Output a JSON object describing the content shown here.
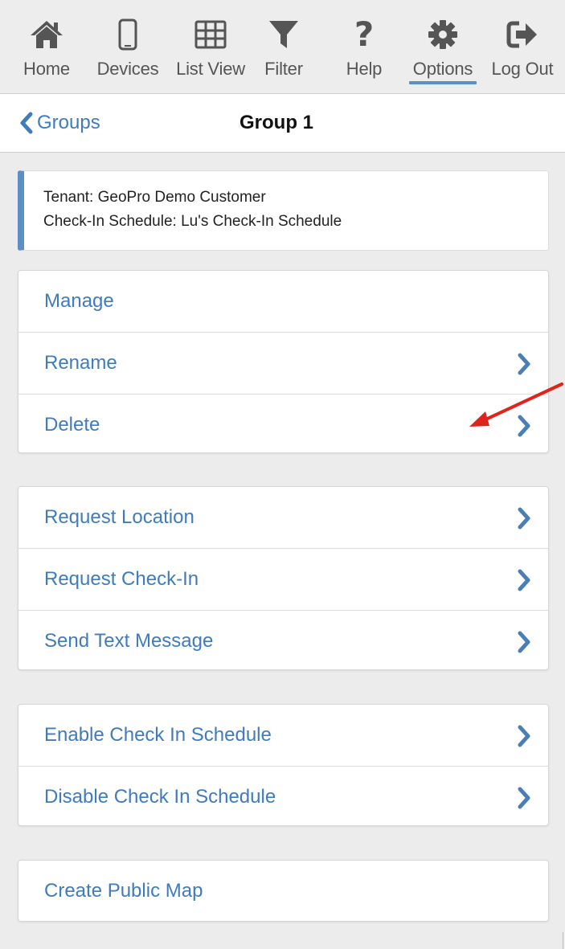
{
  "nav": {
    "items": [
      {
        "label": "Home",
        "icon": "home-icon"
      },
      {
        "label": "Devices",
        "icon": "device-icon"
      },
      {
        "label": "List View",
        "icon": "grid-icon"
      },
      {
        "label": "Filter",
        "icon": "filter-icon"
      },
      {
        "label": "Help",
        "icon": "help-icon"
      },
      {
        "label": "Options",
        "icon": "gear-icon",
        "active": true
      },
      {
        "label": "Log Out",
        "icon": "logout-icon"
      }
    ]
  },
  "header": {
    "back_label": "Groups",
    "title": "Group 1"
  },
  "info": {
    "tenant": "Tenant: GeoPro Demo Customer",
    "schedule": "Check-In Schedule: Lu's Check-In Schedule"
  },
  "groups": [
    {
      "items": [
        {
          "label": "Manage",
          "chevron": false
        },
        {
          "label": "Rename",
          "chevron": true
        },
        {
          "label": "Delete",
          "chevron": true
        }
      ]
    },
    {
      "items": [
        {
          "label": "Request Location",
          "chevron": true
        },
        {
          "label": "Request Check-In",
          "chevron": true
        },
        {
          "label": "Send Text Message",
          "chevron": true
        }
      ]
    },
    {
      "items": [
        {
          "label": "Enable Check In Schedule",
          "chevron": true
        },
        {
          "label": "Disable Check In Schedule",
          "chevron": true
        }
      ]
    },
    {
      "items": [
        {
          "label": "Create Public Map",
          "chevron": false
        }
      ]
    }
  ],
  "colors": {
    "accent": "#3f7bbd",
    "chevron": "#4a7fb5",
    "active_underline": "#5b8fc5",
    "annotation_arrow": "#e0231b",
    "icon_gray": "#555555"
  }
}
